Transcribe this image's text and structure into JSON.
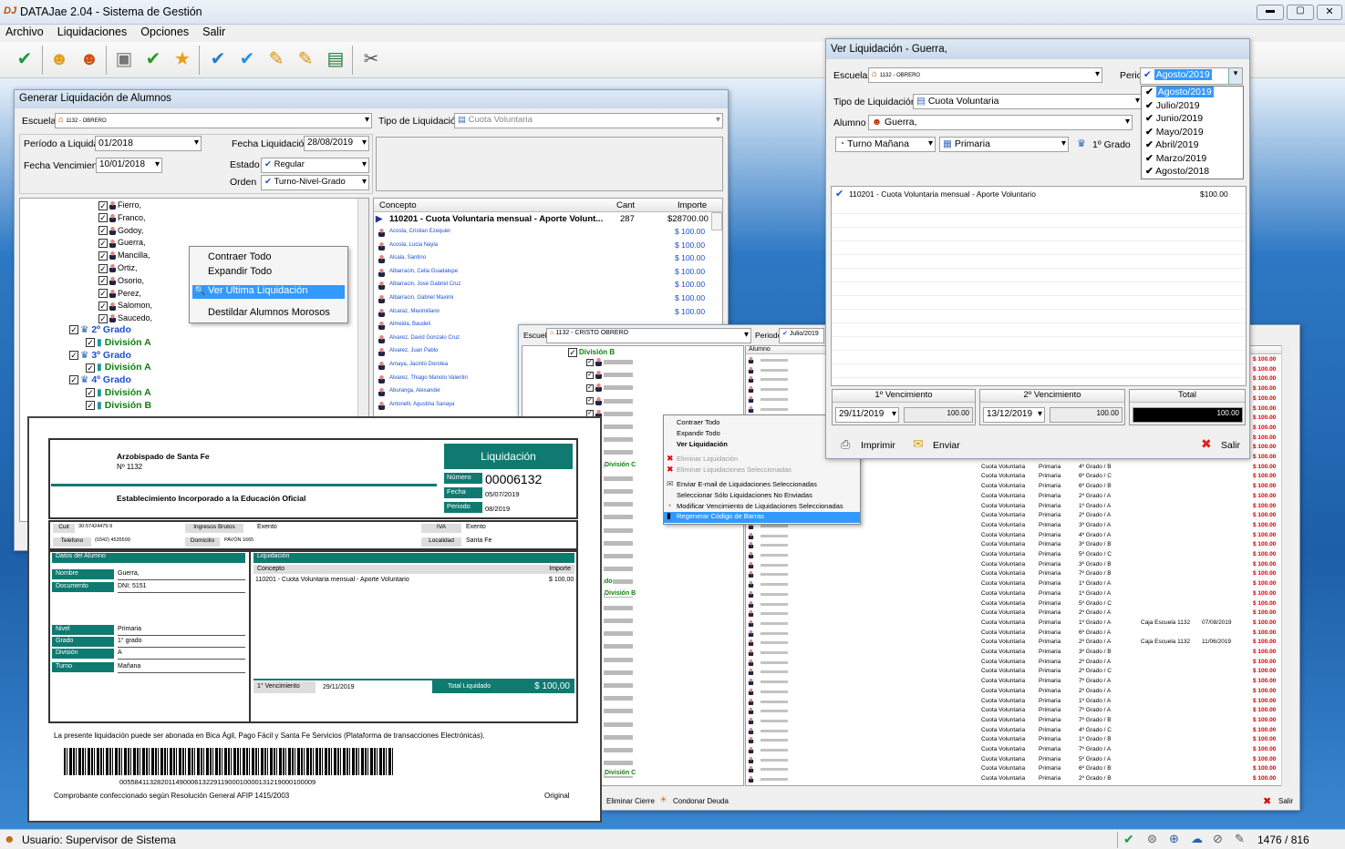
{
  "app": {
    "title": "DATAJae 2.04 - Sistema de Gestión",
    "logo": "DJ",
    "menu": [
      "Archivo",
      "Liquidaciones",
      "Opciones",
      "Salir"
    ]
  },
  "toolbar_icons": [
    "check-circle-icon",
    "user-icon",
    "user-dark-icon",
    "gift-icon",
    "check-icon",
    "star-icon",
    "double-check-icon",
    "check-blue-icon",
    "edit-icon",
    "edit2-icon",
    "money-icon",
    "tools-icon"
  ],
  "status": {
    "user": "Usuario: Supervisor de Sistema",
    "coords": "1476 / 816"
  },
  "gen": {
    "title": "Generar Liquidación de Alumnos",
    "escuela_label": "Escuela",
    "escuela_value": "1132 - OBRERO",
    "tipo_label": "Tipo de Liquidación",
    "tipo_value": "Cuota Voluntaria",
    "periodo_label": "Período a Liquidar",
    "periodo_value": "01/2018",
    "fecha_liq_label": "Fecha Liquidación",
    "fecha_liq_value": "28/08/2019",
    "fecha_venc_label": "Fecha Vencimiento",
    "fecha_venc_value": "10/01/2018",
    "estado_label": "Estado",
    "estado_value": "Regular",
    "orden_label": "Orden",
    "orden_value": "Turno-Nivel-Grado",
    "tree_students": [
      "Fierro,",
      "Franco,",
      "Godoy,",
      "Guerra,",
      "Mancilla,",
      "Ortiz,",
      "Osorio,",
      "Perez,",
      "Salomon,",
      "Saucedo,"
    ],
    "tree_nodes": [
      {
        "t": "2º Grado",
        "c": "grade"
      },
      {
        "t": "División A",
        "c": "div"
      },
      {
        "t": "3º Grado",
        "c": "grade"
      },
      {
        "t": "División A",
        "c": "div"
      },
      {
        "t": "4º Grado",
        "c": "grade"
      },
      {
        "t": "División A",
        "c": "div"
      },
      {
        "t": "División B",
        "c": "div"
      }
    ],
    "grid_cols": [
      "Concepto",
      "Cant",
      "Importe"
    ],
    "grid_main": {
      "concepto": "110201 - Cuota Voluntaria mensual - Aporte Volunt...",
      "cant": "287",
      "importe": "$28700.00"
    },
    "grid_rows": [
      {
        "n": "Acosta, Cristian Ezequiel",
        "v": "$ 100.00"
      },
      {
        "n": "Acosta, Lucia Nayla",
        "v": "$ 100.00"
      },
      {
        "n": "Alcala, Santino",
        "v": "$ 100.00"
      },
      {
        "n": "Albarracin, Celia Guadalupe",
        "v": "$ 100.00"
      },
      {
        "n": "Albarracin, José Gabriel Cruz",
        "v": "$ 100.00"
      },
      {
        "n": "Albarracin, Gabriel Maximi",
        "v": "$ 100.00"
      },
      {
        "n": "Alcaraz, Maximiliano",
        "v": "$ 100.00"
      },
      {
        "n": "Almeida, Baudeli",
        "v": ""
      },
      {
        "n": "Alvarez, David Gonzalo Cruz",
        "v": ""
      },
      {
        "n": "Alvarez, Juan Pablo",
        "v": ""
      },
      {
        "n": "Amaya, Jacinto Dorotea",
        "v": ""
      },
      {
        "n": "Alvarez, Thiago Manolo Valentin",
        "v": ""
      },
      {
        "n": "Aburanga, Alexander",
        "v": ""
      },
      {
        "n": "Antonelli, Agustina Sanaya",
        "v": ""
      }
    ]
  },
  "ctx1": [
    "Contraer Todo",
    "Expandir Todo",
    "Ver Última Liquidación",
    "Destildar Alumnos Morosos"
  ],
  "ver": {
    "title": "Ver Liquidación - Guerra,",
    "escuela_label": "Escuela",
    "escuela_value": "1132 - OBRERO",
    "periodo_label": "Periodo",
    "periodo_value": "Agosto/2019",
    "periodos": [
      "Agosto/2019",
      "Julio/2019",
      "Junio/2019",
      "Mayo/2019",
      "Abril/2019",
      "Marzo/2019",
      "Agosto/2018"
    ],
    "tipo_label": "Tipo de Liquidación",
    "tipo_value": "Cuota Voluntaria",
    "alumno_label": "Alumno",
    "alumno_value": "Guerra,",
    "turno": "Turno Mañana",
    "nivel": "Primaria",
    "grado": "1º Grado",
    "item": {
      "concepto": "110201 - Cuota Voluntaria mensual - Aporte Voluntario",
      "importe": "$100.00"
    },
    "v1_label": "1º Vencimiento",
    "v1_date": "29/11/2019",
    "v1_amount": "100.00",
    "v2_label": "2º Vencimiento",
    "v2_date": "13/12/2019",
    "v2_amount": "100.00",
    "total_label": "Total",
    "total_value": "100.00",
    "imprimir": "Imprimir",
    "enviar": "Enviar",
    "salir": "Salir"
  },
  "back": {
    "escuela_label": "Escuela",
    "escuela_value": "1132 - CRISTO OBRERO",
    "periodo_label": "Periodo",
    "periodo_value": "Julio/2019",
    "tree_top": "División B",
    "alumno_col": "Alumno",
    "div_labels": [
      "División C",
      "do",
      "División B",
      "División C",
      "do",
      "División C"
    ],
    "ctx": [
      "Contraer Todo",
      "Expandir Todo",
      "Ver Liquidación",
      "Eliminar Liquidación",
      "Eliminar Liquidaciones Seleccionadas",
      "Enviar E-mail de Liquidaciones Seleccionadas",
      "Seleccionar Sólo Liquidaciones No Enviadas",
      "Modificar Vencimiento de Liquidaciones Seleccionadas",
      "Regenerar Código de Barras"
    ],
    "eliminar_cierre": "Eliminar Cierre",
    "condonar": "Condonar Deuda",
    "salir": "Salir",
    "tipo": "Cuota Voluntaria",
    "nivel": "Primaria",
    "grades": [
      "4º Grado / B",
      "6º Grado / C",
      "6º Grado / B",
      "2º Grado / A",
      "1º Grado / A",
      "2º Grado / A",
      "3º Grado / A",
      "4º Grado / A",
      "3º Grado / B",
      "5º Grado / C",
      "3º Grado / B",
      "7º Grado / B",
      "1º Grado / A",
      "1º Grado / A",
      "5º Grado / C",
      "2º Grado / A",
      "1º Grado / A",
      "6º Grado / A",
      "2º Grado / A",
      "3º Grado / B",
      "2º Grado / A",
      "2º Grado / C",
      "7º Grado / A",
      "2º Grado / A",
      "1º Grado / A",
      "7º Grado / A",
      "7º Grado / B",
      "4º Grado / C",
      "1º Grado / B",
      "7º Grado / A",
      "5º Grado / A",
      "6º Grado / B",
      "2º Grado / B",
      "2º Grado / A",
      "1º Grado / A"
    ],
    "caja": {
      "row": 16,
      "a": "Caja Escuela 1132",
      "ad": "07/08/2019",
      "b": "Caja Escuela 1132",
      "bd": "11/06/2019"
    },
    "importe": "$ 100.00"
  },
  "doc": {
    "school": "Arzobispado de Santa Fe",
    "school2": "Nº 1132",
    "incorporado": "Establecimiento Incorporado a la Educación Oficial",
    "liq_title": "Liquidación",
    "numero_label": "Número",
    "numero": "00006132",
    "fecha_label": "Fecha",
    "fecha": "05/07/2019",
    "periodo_label": "Periodo",
    "periodo": "08/2019",
    "cuit_label": "Cuit",
    "cuit": "30-57424475-9",
    "ib_label": "Ingresos Brutos",
    "ib": "Exento",
    "iva_label": "IVA",
    "iva": "Exento",
    "tel_label": "Teléfono",
    "tel": "(0342) 4535599",
    "dom_label": "Domicilio",
    "dom": "PAVÓN 1665",
    "loc_label": "Localidad",
    "loc": "Santa Fe",
    "datos_label": "Datos del Alumno",
    "nombre_label": "Nombre",
    "nombre": "Guerra,",
    "doc_label": "Documento",
    "dni": "DNI: 5151",
    "nivel_label": "Nivel",
    "nivel": "Primaria",
    "grado_label": "Grado",
    "grado": "1° grado",
    "division_label": "División",
    "division": "A",
    "turno_label": "Turno",
    "turno": "Mañana",
    "liq_label": "Liquidación",
    "concepto_label": "Concepto",
    "importe_label": "Importe",
    "item": "110201 - Cuota Voluntaria mensual - Aporte Voluntario",
    "item_importe": "$ 100,00",
    "venc_label": "1° Vencimiento",
    "venc_date": "29/11/2019",
    "total_label": "Total Liquidado",
    "total": "$ 100,00",
    "nota": "La presente liquidación puede ser abonada en Bica Ágil, Pago Fácil y Santa Fe Servicios (Plataforma de transacciones Electrónicas).",
    "barcode": "0055841132820114900061322911900010000131219000100009",
    "resolucion": "Comprobante confeccionado según Resolución General AFIP 1415/2003",
    "original": "Original"
  },
  "colors": {
    "teal": "#0f7a70",
    "red": "#d00000",
    "select": "#3399ff"
  }
}
